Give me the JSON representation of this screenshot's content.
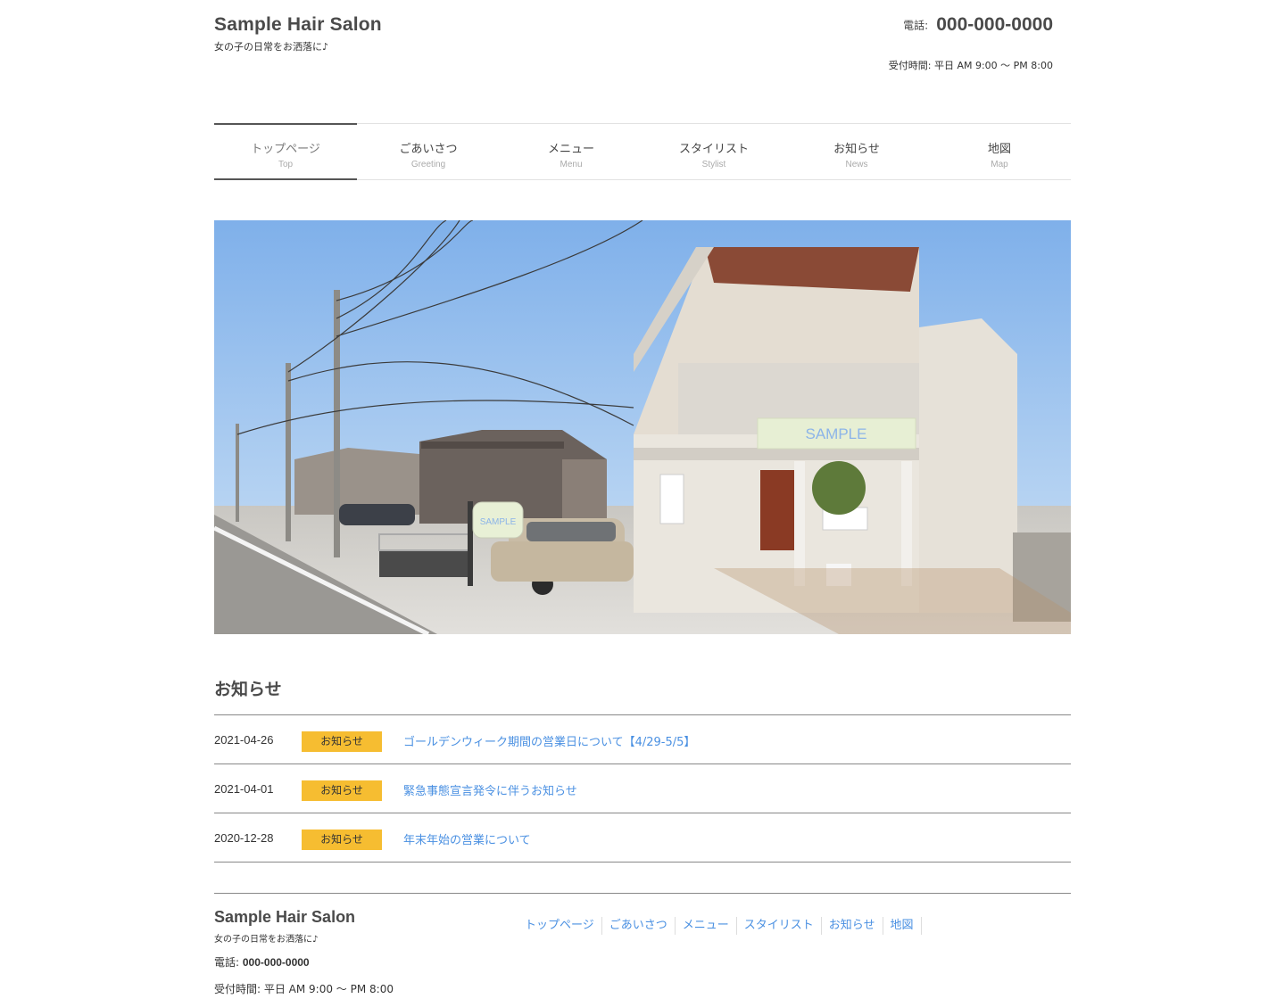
{
  "header": {
    "site_title": "Sample Hair Salon",
    "site_description": "女の子の日常をお洒落に♪",
    "tel_label": "電話:",
    "tel_number": "000-000-0000",
    "hours": "受付時間: 平日 AM 9:00 〜 PM 8:00"
  },
  "nav": [
    {
      "jp": "トップページ",
      "en": "Top",
      "active": true
    },
    {
      "jp": "ごあいさつ",
      "en": "Greeting"
    },
    {
      "jp": "メニュー",
      "en": "Menu"
    },
    {
      "jp": "スタイリスト",
      "en": "Stylist"
    },
    {
      "jp": "お知らせ",
      "en": "News"
    },
    {
      "jp": "地図",
      "en": "Map"
    }
  ],
  "hero": {
    "sign_large": "SAMPLE",
    "sign_small": "SAMPLE"
  },
  "news": {
    "title": "お知らせ",
    "items": [
      {
        "date": "2021-04-26",
        "category": "お知らせ",
        "title": "ゴールデンウィーク期間の営業日について【4/29-5/5】"
      },
      {
        "date": "2021-04-01",
        "category": "お知らせ",
        "title": "緊急事態宣言発令に伴うお知らせ"
      },
      {
        "date": "2020-12-28",
        "category": "お知らせ",
        "title": "年末年始の営業について"
      }
    ]
  },
  "footer": {
    "site_title": "Sample Hair Salon",
    "site_description": "女の子の日常をお洒落に♪",
    "tel_label": "電話:",
    "tel_number": "000-000-0000",
    "hours": "受付時間: 平日 AM 9:00 〜 PM 8:00",
    "nav": [
      "トップページ",
      "ごあいさつ",
      "メニュー",
      "スタイリスト",
      "お知らせ",
      "地図"
    ]
  },
  "colors": {
    "badge": "#f6bd31",
    "link": "#4a90e2",
    "text": "#4a4a4a"
  }
}
